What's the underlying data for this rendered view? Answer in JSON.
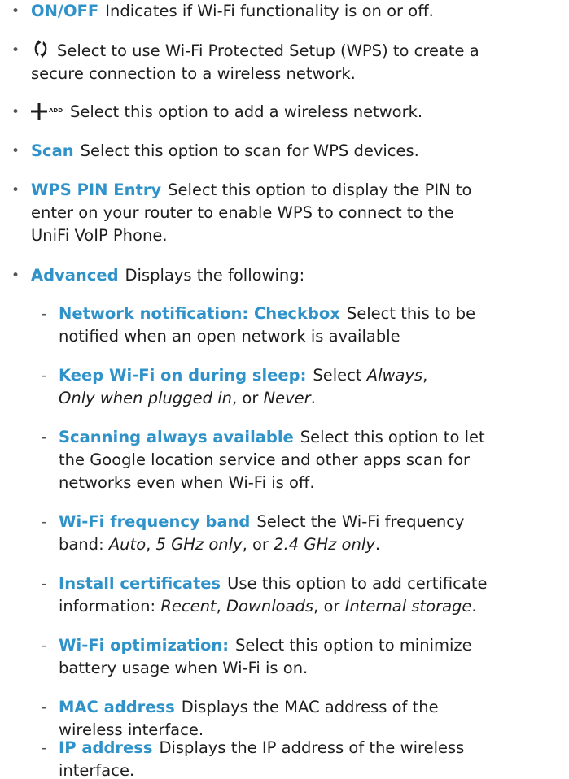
{
  "items": [
    {
      "term": "ON/OFF",
      "desc": "Indicates if Wi-Fi functionality is on or off."
    },
    {
      "icon": "wps-icon",
      "desc_line1": "Select to use Wi-Fi Protected Setup (WPS) to create a",
      "desc_line2": "secure connection to a wireless network."
    },
    {
      "icon": "add-icon",
      "icon_label": "ADD",
      "desc": "Select this option to add a wireless network."
    },
    {
      "term": "Scan",
      "desc": "Select this option to scan for WPS devices."
    },
    {
      "term": "WPS PIN Entry",
      "desc_line1": "Select this option to display the PIN to",
      "desc_line2": "enter on your router to enable WPS to connect to the",
      "desc_line3": "UniFi VoIP Phone."
    },
    {
      "term": "Advanced",
      "desc": "Displays the following:"
    }
  ],
  "advanced": [
    {
      "term": "Network notification: Checkbox",
      "desc_line1": "Select this to be",
      "desc_line2": "notified when an open network is available"
    },
    {
      "term": "Keep Wi-Fi on during sleep:",
      "desc_line1_pre": "Select ",
      "opt1": "Always",
      "sep1": ",",
      "opt2": "Only when plugged in",
      "sep2": ", or ",
      "opt3": "Never",
      "end": "."
    },
    {
      "term": "Scanning always available",
      "desc_line1": "Select this option to let",
      "desc_line2": "the Google location service and other apps scan for",
      "desc_line3": "networks even when Wi-Fi is off."
    },
    {
      "term": "Wi-Fi frequency band",
      "desc_line1": "Select the Wi-Fi frequency",
      "desc_line2_pre": "band: ",
      "opt1": "Auto",
      "sep1": ", ",
      "opt2": "5 GHz only",
      "sep2": ", or ",
      "opt3": "2.4 GHz only",
      "end": "."
    },
    {
      "term": "Install certificates",
      "desc_line1": "Use this option to add certificate",
      "desc_line2_pre": "information: ",
      "opt1": "Recent",
      "sep1": ", ",
      "opt2": "Downloads",
      "sep2": ", or ",
      "opt3": "Internal storage",
      "end": "."
    },
    {
      "term": "Wi-Fi optimization:",
      "desc_line1": "Select this option to minimize",
      "desc_line2": "battery usage when Wi-Fi is on."
    },
    {
      "term": "MAC address",
      "desc_line1": "Displays the MAC address of the",
      "desc_line2": "wireless interface."
    },
    {
      "term": "IP address",
      "desc_line1": "Displays the IP address of the wireless",
      "desc_line2": "interface."
    }
  ],
  "colors": {
    "accent": "#2f92c9",
    "text": "#1e1e1e"
  }
}
